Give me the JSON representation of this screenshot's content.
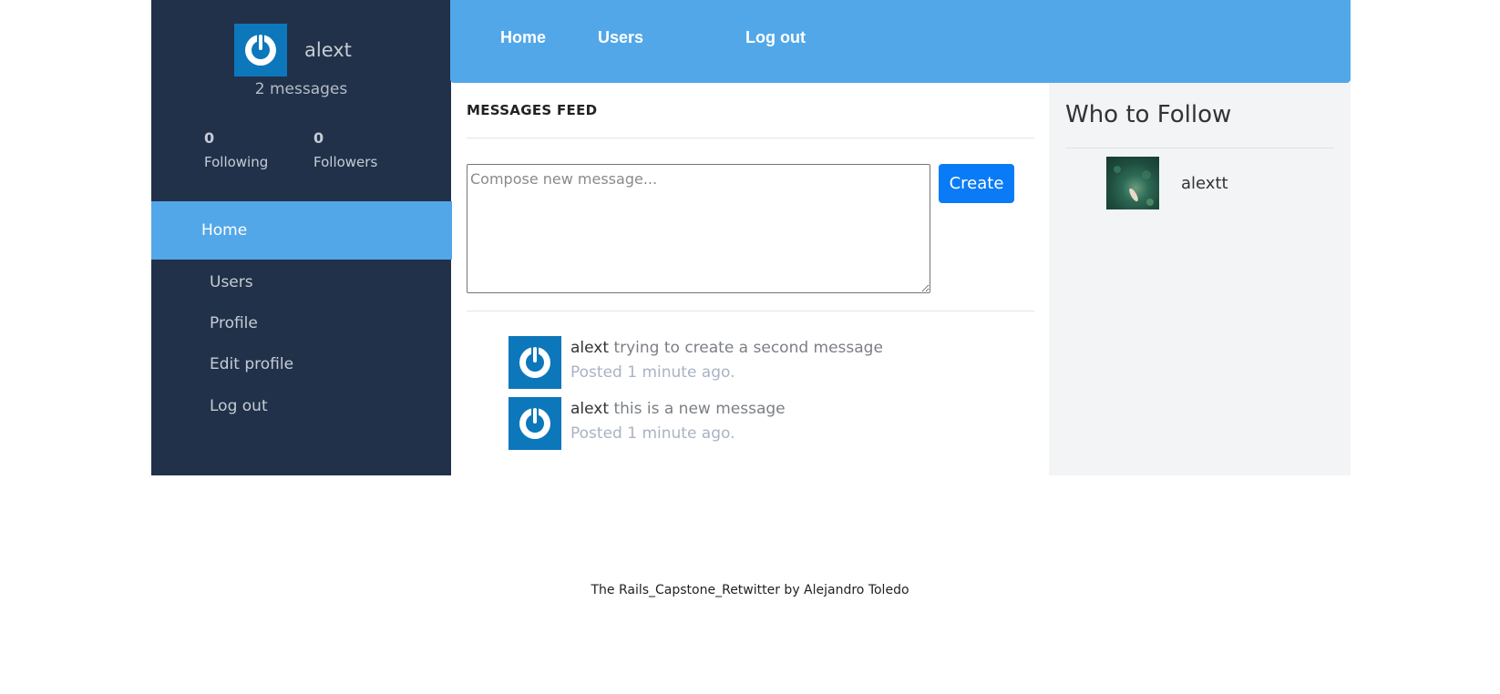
{
  "sidebar": {
    "username": "alext",
    "message_count": "2 messages",
    "following": {
      "count": "0",
      "label": "Following"
    },
    "followers": {
      "count": "0",
      "label": "Followers"
    },
    "active_item": "Home",
    "items": [
      {
        "label": "Users"
      },
      {
        "label": "Profile"
      },
      {
        "label": "Edit profile"
      },
      {
        "label": "Log out"
      }
    ]
  },
  "topnav": {
    "items": [
      {
        "label": "Home"
      },
      {
        "label": "Users"
      },
      {
        "label": "Log out"
      }
    ]
  },
  "feed": {
    "title": "MESSAGES FEED",
    "compose_placeholder": "Compose new message...",
    "create_label": "Create",
    "messages": [
      {
        "author": "alext",
        "text": "trying to create a second message",
        "posted": "Posted 1 minute ago."
      },
      {
        "author": "alext",
        "text": "this is a new message",
        "posted": "Posted 1 minute ago."
      }
    ]
  },
  "who_to_follow": {
    "title": "Who to Follow",
    "users": [
      {
        "name": "alextt"
      }
    ]
  },
  "footer": {
    "text": "The Rails_Capstone_Retwitter by Alejandro Toledo"
  },
  "colors": {
    "sidebar_bg": "#21314a",
    "accent_blue": "#52a7e8",
    "button_blue": "#0a7bf7",
    "right_panel_bg": "#f3f4f6"
  }
}
